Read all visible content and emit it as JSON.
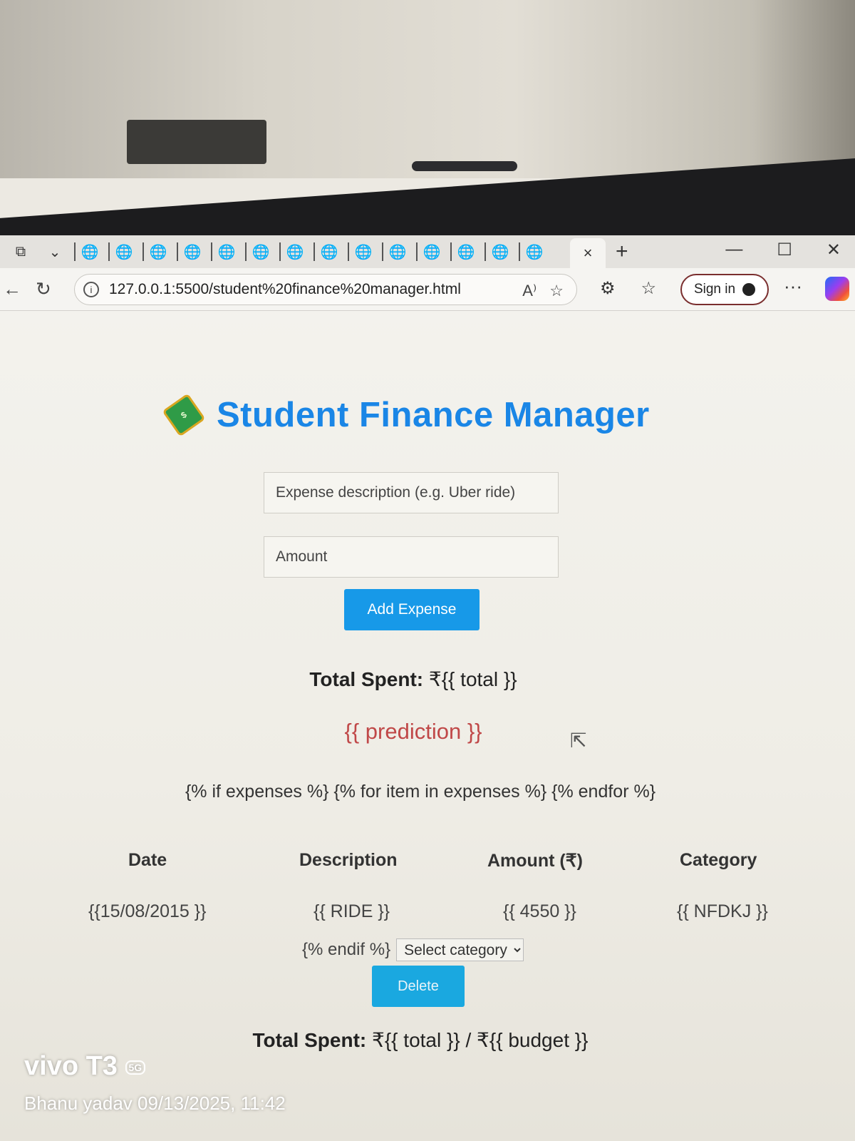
{
  "browser": {
    "tabs_count_icons": 14,
    "active_tab_close": "×",
    "new_tab": "+",
    "window_controls": [
      "—",
      "☐",
      "✕"
    ],
    "url": "127.0.0.1:5500/student%20finance%20manager.html",
    "sign_in_label": "Sign in",
    "more_label": "···"
  },
  "app": {
    "title": "Student Finance Manager",
    "description_placeholder": "Expense description (e.g. Uber ride)",
    "amount_placeholder": "Amount",
    "add_button": "Add Expense",
    "total_label": "Total Spent:",
    "total_value": "₹{{ total }}",
    "prediction": "{{ prediction }}",
    "jinja_loop": "{% if expenses %} {% for item in expenses %} {% endfor %}",
    "table": {
      "headers": [
        "Date",
        "Description",
        "Amount (₹)",
        "Category"
      ],
      "row": [
        "{{15/08/2015 }}",
        "{{ RIDE }}",
        "{{ 4550 }}",
        "{{ NFDKJ }}"
      ]
    },
    "endif_text": "{% endif %}",
    "category_select": "Select category",
    "delete_button": "Delete",
    "footer_total_label": "Total Spent:",
    "footer_total_value": "₹{{ total }} / ₹{{ budget }}"
  },
  "watermark": {
    "brand": "vivo T3",
    "badge": "5G",
    "meta": "Bhanu yadav  09/13/2025, 11:42"
  },
  "colors": {
    "title": "#1a86e6",
    "button": "#1799e8",
    "prediction": "#c04848"
  }
}
